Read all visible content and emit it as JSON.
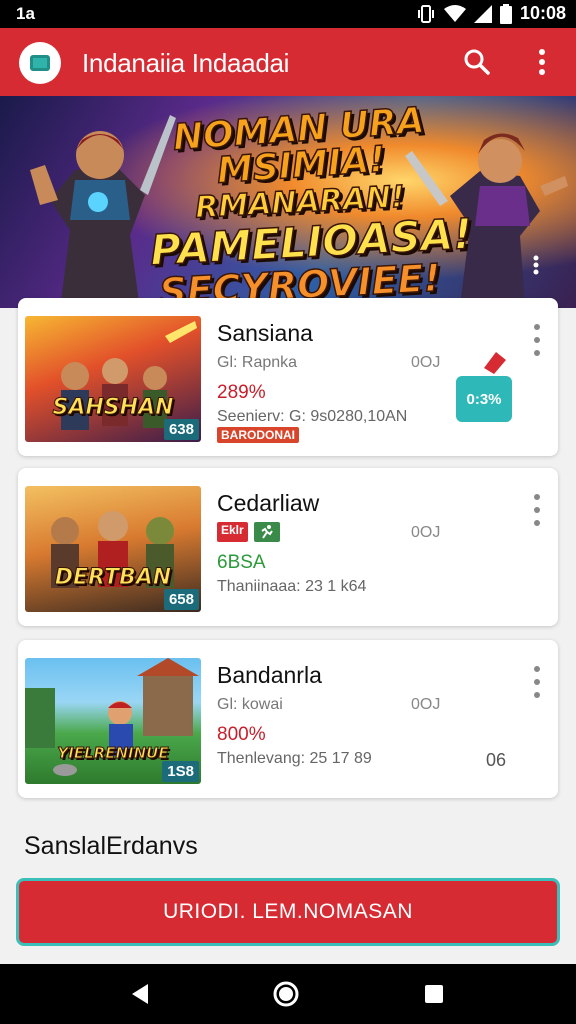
{
  "status_bar": {
    "left": "1a",
    "time": "10:08"
  },
  "app_bar": {
    "title": "Indanaiia Indaadai",
    "icons": [
      "app-logo",
      "search-icon",
      "more-vert-icon"
    ]
  },
  "hero": {
    "lines": [
      "NOMAN URA MSIMIA!",
      "RMANARAN!",
      "PAMELIOASA!",
      "SECYROVIEE!"
    ]
  },
  "cards": [
    {
      "title": "Sansiana",
      "subtitle": "Gl: Rapnka",
      "code": "0OJ",
      "percent": "289%",
      "meta": "Seenierv: G: 9s0280,10AN",
      "thumb_caption": "SAHSHAN",
      "thumb_badge": "638",
      "tag_label": "BARODONAI",
      "promo_badge": "0:3%",
      "colors": {
        "percent": "#c81e2a",
        "promo": "#2fb8b8"
      }
    },
    {
      "title": "Cedarliaw",
      "subtitle": "",
      "code": "0OJ",
      "percent": "6BSA",
      "meta": "Thaniinaaa: 23 1 k64",
      "thumb_caption": "DERTBAN",
      "thumb_badge": "658",
      "tag_label": "Eklr",
      "colors": {
        "percent": "#2a9a3a"
      }
    },
    {
      "title": "Bandanrla",
      "subtitle": "Gl: kowai",
      "code": "0OJ",
      "percent": "800%",
      "meta": "Thenlevang: 25 17 89",
      "thumb_caption": "YIELRENINUE",
      "thumb_badge": "1S8",
      "trailing": "06",
      "colors": {
        "percent": "#c81e2a"
      }
    }
  ],
  "section_title": "SanslalErdanvs",
  "cta_label": "URIODI. LEM.NOMASAN",
  "nav": [
    "back-icon",
    "home-icon",
    "recents-icon"
  ]
}
